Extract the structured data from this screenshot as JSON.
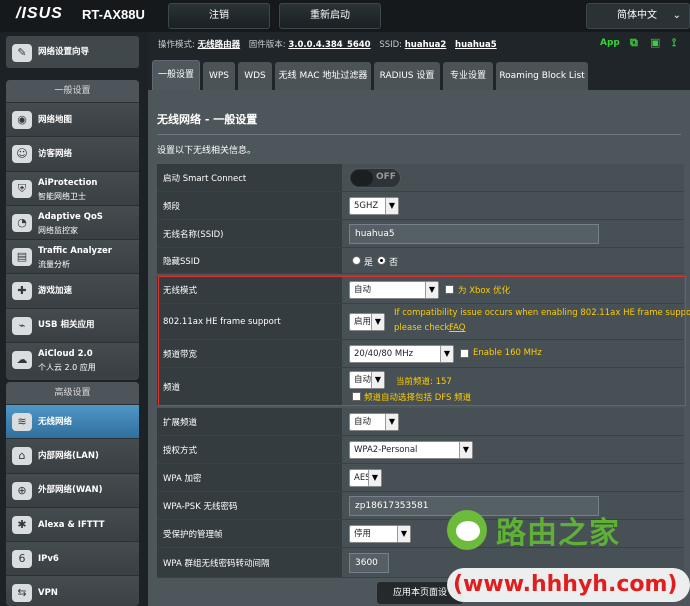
{
  "header": {
    "brand": "/ISUS",
    "model": "RT-AX88U",
    "logout": "注销",
    "reboot": "重新启动",
    "language": "简体中文",
    "lang_arrow": "⌄"
  },
  "status": {
    "op_mode_label": "操作模式:",
    "op_mode": "无线路由器",
    "fw_label": "固件版本:",
    "fw": "3.0.0.4.384_5640",
    "ssid_label": "SSID:",
    "ssid1": "huahua2",
    "ssid2": "huahua5",
    "app": "App"
  },
  "sidebar": {
    "qis": "网络设置向导",
    "general_title": "一般设置",
    "general": [
      {
        "label": "网络地图",
        "sub": "",
        "icon": "◉"
      },
      {
        "label": "访客网络",
        "sub": "",
        "icon": "☺"
      },
      {
        "label": "AiProtection",
        "sub": "智能网络卫士",
        "icon": "⛨"
      },
      {
        "label": "Adaptive QoS",
        "sub": "网络监控家",
        "icon": "◔"
      },
      {
        "label": "Traffic Analyzer",
        "sub": "流量分析",
        "icon": "▤"
      },
      {
        "label": "游戏加速",
        "sub": "",
        "icon": "✚"
      },
      {
        "label": "USB 相关应用",
        "sub": "",
        "icon": "⌁"
      },
      {
        "label": "AiCloud 2.0",
        "sub": "个人云 2.0 应用",
        "icon": "☁"
      }
    ],
    "adv_title": "高级设置",
    "advanced": [
      {
        "label": "无线网络",
        "icon": "≋"
      },
      {
        "label": "内部网络(LAN)",
        "icon": "⌂"
      },
      {
        "label": "外部网络(WAN)",
        "icon": "⊕"
      },
      {
        "label": "Alexa & IFTTT",
        "icon": "✱"
      },
      {
        "label": "IPv6",
        "icon": "6"
      },
      {
        "label": "VPN",
        "icon": "⇆"
      }
    ]
  },
  "tabs": [
    "一般设置",
    "WPS",
    "WDS",
    "无线 MAC 地址过滤器",
    "RADIUS 设置",
    "专业设置",
    "Roaming Block List"
  ],
  "page": {
    "title": "无线网络 - 一般设置",
    "desc": "设置以下无线相关信息。"
  },
  "form": {
    "smart_connect": {
      "label": "启动 Smart Connect",
      "state": "OFF"
    },
    "band": {
      "label": "频段",
      "value": "5GHZ"
    },
    "ssid": {
      "label": "无线名称(SSID)",
      "value": "huahua5"
    },
    "hide_ssid": {
      "label": "隐藏SSID",
      "yes": "是",
      "no": "否",
      "selected": "否"
    },
    "wireless_mode": {
      "label": "无线模式",
      "value": "自动",
      "xbox": "为 Xbox 优化"
    },
    "he_frame": {
      "label": "802.11ax HE frame support",
      "value": "启用",
      "note1": "If compatibility issue occurs when enabling 802.11ax HE frame support,",
      "note2": "please check: ",
      "faq": "FAQ"
    },
    "bandwidth": {
      "label": "频道带宽",
      "value": "20/40/80 MHz",
      "enable160": "Enable 160 MHz"
    },
    "channel": {
      "label": "频道",
      "value": "自动",
      "current": "当前频道: 157",
      "dfs": "频道自动选择包括 DFS 频道"
    },
    "ext_channel": {
      "label": "扩展频道",
      "value": "自动"
    },
    "auth": {
      "label": "授权方式",
      "value": "WPA2-Personal"
    },
    "wpa_enc": {
      "label": "WPA 加密",
      "value": "AES"
    },
    "psk": {
      "label": "WPA-PSK 无线密码",
      "value": "zp18617353581"
    },
    "pmf": {
      "label": "受保护的管理帧",
      "value": "停用"
    },
    "rekey": {
      "label": "WPA 群组无线密码转动间隔",
      "value": "3600"
    }
  },
  "apply": "应用本页面设",
  "watermark": {
    "brand": "路由之家",
    "url": "(www.hhhyh.com)"
  }
}
